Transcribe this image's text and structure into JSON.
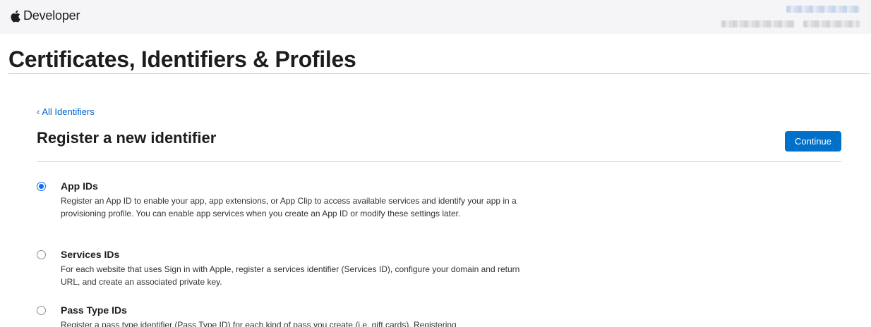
{
  "nav": {
    "brand": "Developer"
  },
  "header": {
    "title": "Certificates, Identifiers & Profiles"
  },
  "breadcrumb": {
    "back_label": "All Identifiers"
  },
  "section": {
    "title": "Register a new identifier",
    "continue_label": "Continue"
  },
  "options": [
    {
      "title": "App IDs",
      "description": "Register an App ID to enable your app, app extensions, or App Clip to access available services and identify your app in a provisioning profile. You can enable app services when you create an App ID or modify these settings later.",
      "selected": true
    },
    {
      "title": "Services IDs",
      "description": "For each website that uses Sign in with Apple, register a services identifier (Services ID), configure your domain and return URL, and create an associated private key.",
      "selected": false
    },
    {
      "title": "Pass Type IDs",
      "description": "Register a pass type identifier (Pass Type ID) for each kind of pass you create (i.e. gift cards). Registering",
      "selected": false
    }
  ],
  "colors": {
    "link": "#0066cc",
    "primary_button": "#0070c9",
    "radio_selected": "#0a6cff",
    "nav_background": "#f5f5f7"
  }
}
